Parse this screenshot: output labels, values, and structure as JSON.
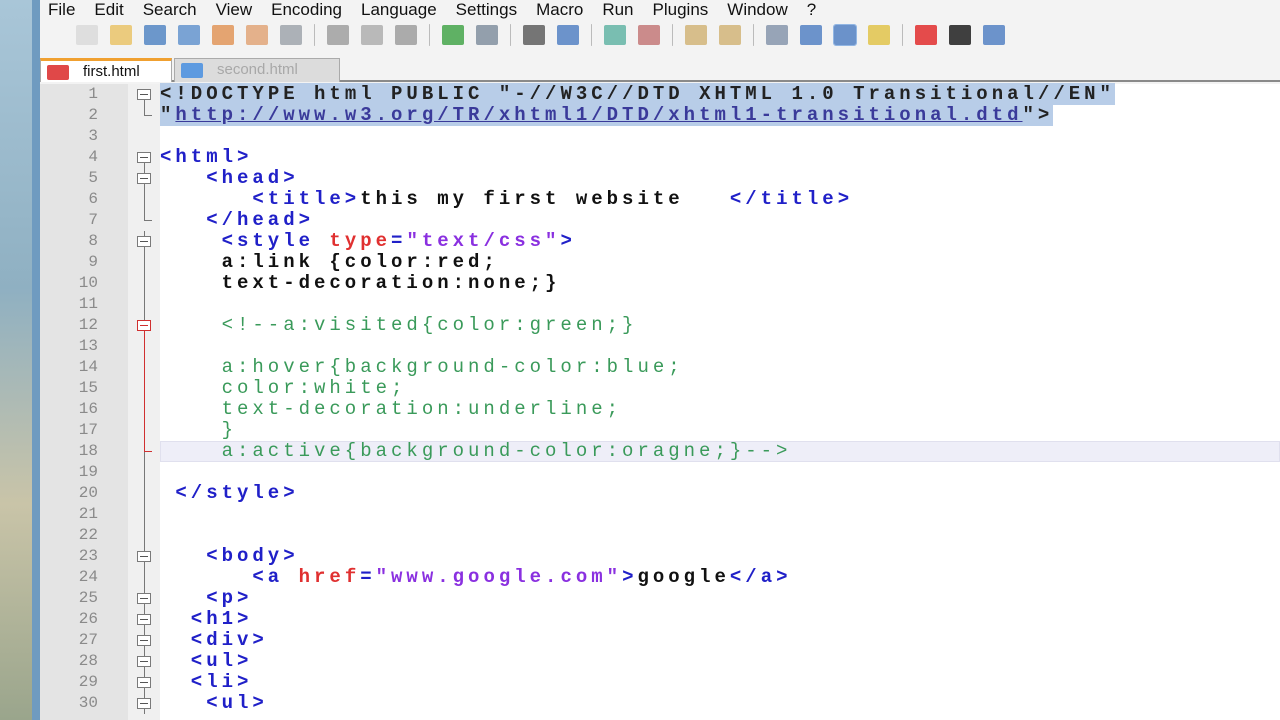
{
  "menu": [
    "File",
    "Edit",
    "Search",
    "View",
    "Encoding",
    "Language",
    "Settings",
    "Macro",
    "Run",
    "Plugins",
    "Window",
    "?"
  ],
  "toolbar": [
    "new-file",
    "open-file",
    "save",
    "save-all",
    "close",
    "close-all",
    "print",
    "sep",
    "cut",
    "copy",
    "paste",
    "sep",
    "undo",
    "redo",
    "sep",
    "find",
    "replace",
    "sep",
    "zoom-in",
    "zoom-out",
    "sep",
    "sync-vertical",
    "sync-horizontal",
    "sep",
    "word-wrap",
    "show-all-chars",
    "indent-guide",
    "user-language",
    "sep",
    "record-macro",
    "stop-macro",
    "play-macro"
  ],
  "toolbar_colors": {
    "new-file": "#d8d8d8",
    "open-file": "#e8c060",
    "save": "#4a7fc0",
    "save-all": "#5b8fcc",
    "close": "#e09050",
    "close-all": "#e0a070",
    "print": "#9aa0a8",
    "cut": "#9a9a9a",
    "copy": "#aaaaaa",
    "paste": "#999999",
    "undo": "#3aa040",
    "redo": "#7a8a9a",
    "find": "#555",
    "replace": "#4a7ac0",
    "zoom-in": "#5ab0a0",
    "zoom-out": "#c07070",
    "sync-vertical": "#d0b070",
    "sync-horizontal": "#d0b070",
    "word-wrap": "#8090a8",
    "show-all-chars": "#4a7ac0",
    "indent-guide": "#4a7ac0",
    "user-language": "#e0c040",
    "record-macro": "#e02020",
    "stop-macro": "#111",
    "play-macro": "#4a7ac0"
  },
  "tabs": [
    {
      "label": "first.html",
      "active": true
    },
    {
      "label": "second.html",
      "active": false
    }
  ],
  "current_line": 18,
  "lines": [
    {
      "n": 1,
      "i": 0,
      "f": "box",
      "sel": true,
      "s": [
        [
          "<!DOCTYPE html PUBLIC \"",
          "doc"
        ],
        [
          "-//W3C//DTD XHTML 1.0 Transitional//EN",
          "doc"
        ],
        [
          "\"",
          "doc"
        ]
      ]
    },
    {
      "n": 2,
      "i": 0,
      "f": "end",
      "sel": true,
      "s": [
        [
          "\"",
          "doc"
        ],
        [
          "http://www.w3.org/TR/xhtml1/DTD/xhtml1-transitional.dtd",
          "url"
        ],
        [
          "\">",
          "doc"
        ]
      ]
    },
    {
      "n": 3,
      "i": 0,
      "f": "",
      "s": []
    },
    {
      "n": 4,
      "i": 0,
      "f": "box",
      "s": [
        [
          "<html>",
          "tag"
        ]
      ]
    },
    {
      "n": 5,
      "i": 3,
      "f": "box",
      "s": [
        [
          "<head>",
          "tag"
        ]
      ]
    },
    {
      "n": 6,
      "i": 6,
      "f": "line",
      "s": [
        [
          "<title>",
          "tag"
        ],
        [
          "this my first website   ",
          "txt"
        ],
        [
          "</title>",
          "tag"
        ]
      ]
    },
    {
      "n": 7,
      "i": 3,
      "f": "end",
      "s": [
        [
          "</head>",
          "tag"
        ]
      ]
    },
    {
      "n": 8,
      "i": 4,
      "f": "box",
      "s": [
        [
          "<style ",
          "tag"
        ],
        [
          "type",
          "attr"
        ],
        [
          "=",
          "tag"
        ],
        [
          "\"text/css\"",
          "str"
        ],
        [
          ">",
          "tag"
        ]
      ]
    },
    {
      "n": 9,
      "i": 4,
      "f": "line",
      "s": [
        [
          "a:link {color:red;",
          "txt"
        ]
      ]
    },
    {
      "n": 10,
      "i": 4,
      "f": "line",
      "s": [
        [
          "text-decoration:none;}",
          "txt"
        ]
      ]
    },
    {
      "n": 11,
      "i": 0,
      "f": "line",
      "s": []
    },
    {
      "n": 12,
      "i": 4,
      "f": "redbox",
      "s": [
        [
          "<!--a:visited{color:green;}",
          "cmt"
        ]
      ]
    },
    {
      "n": 13,
      "i": 0,
      "f": "red",
      "s": []
    },
    {
      "n": 14,
      "i": 4,
      "f": "red",
      "s": [
        [
          "a:hover{background-color:blue;",
          "cmt"
        ]
      ]
    },
    {
      "n": 15,
      "i": 4,
      "f": "red",
      "s": [
        [
          "color:white;",
          "cmt"
        ]
      ]
    },
    {
      "n": 16,
      "i": 4,
      "f": "red",
      "s": [
        [
          "text-decoration:underline;",
          "cmt"
        ]
      ]
    },
    {
      "n": 17,
      "i": 4,
      "f": "red",
      "s": [
        [
          "}",
          "cmt"
        ]
      ]
    },
    {
      "n": 18,
      "i": 4,
      "f": "redend",
      "s": [
        [
          "a:active{background-color:oragne;}-->",
          "cmt"
        ]
      ]
    },
    {
      "n": 19,
      "i": 0,
      "f": "line",
      "s": []
    },
    {
      "n": 20,
      "i": 1,
      "f": "line",
      "s": [
        [
          "</style>",
          "tag"
        ]
      ]
    },
    {
      "n": 21,
      "i": 0,
      "f": "line",
      "s": []
    },
    {
      "n": 22,
      "i": 0,
      "f": "line",
      "s": []
    },
    {
      "n": 23,
      "i": 3,
      "f": "box",
      "s": [
        [
          "<body>",
          "tag"
        ]
      ]
    },
    {
      "n": 24,
      "i": 6,
      "f": "line",
      "s": [
        [
          "<a ",
          "tag"
        ],
        [
          "href",
          "attr"
        ],
        [
          "=",
          "tag"
        ],
        [
          "\"www.google.com\"",
          "str"
        ],
        [
          ">",
          "tag"
        ],
        [
          "google",
          "txt"
        ],
        [
          "</a>",
          "tag"
        ]
      ]
    },
    {
      "n": 25,
      "i": 3,
      "f": "box",
      "s": [
        [
          "<p>",
          "tag"
        ]
      ]
    },
    {
      "n": 26,
      "i": 2,
      "f": "box",
      "s": [
        [
          "<h1>",
          "tag"
        ]
      ]
    },
    {
      "n": 27,
      "i": 2,
      "f": "box",
      "s": [
        [
          "<div>",
          "tag"
        ]
      ]
    },
    {
      "n": 28,
      "i": 2,
      "f": "box",
      "s": [
        [
          "<ul>",
          "tag"
        ]
      ]
    },
    {
      "n": 29,
      "i": 2,
      "f": "box",
      "s": [
        [
          "<li>",
          "tag"
        ]
      ]
    },
    {
      "n": 30,
      "i": 3,
      "f": "box",
      "s": [
        [
          "<ul>",
          "tag"
        ]
      ]
    }
  ]
}
